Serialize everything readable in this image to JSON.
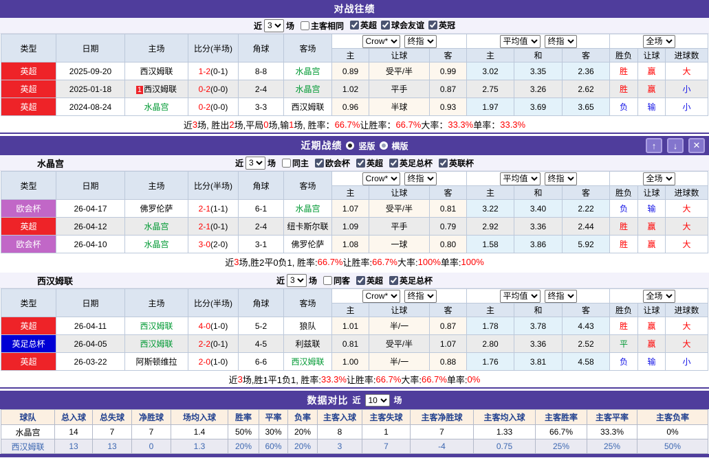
{
  "colors": {
    "accent_purple": "#4f3d9c",
    "button_purple": "#8375cd",
    "league_epl_red": "#ee2328",
    "league_conference_purple": "#c167c7",
    "league_facup_blue": "#0000d5",
    "team_green": "#009933",
    "score_red": "#ff0000",
    "win_red": "#ff0000",
    "lose_blue": "#1212e6",
    "draw_green": "#009933"
  },
  "icons": {
    "up": "↑",
    "down": "↓",
    "close": "✕"
  },
  "matchTable": {
    "cols": [
      "类型",
      "日期",
      "主场",
      "比分(半场)",
      "角球",
      "客场"
    ],
    "subCols": [
      "主",
      "让球",
      "客",
      "主",
      "和",
      "客",
      "胜负",
      "让球",
      "进球数"
    ],
    "dropdowns": [
      "Crow*",
      "终指",
      "平均值",
      "终指",
      "全场"
    ]
  },
  "section1": {
    "title": "对战往绩",
    "filter": {
      "near": "近",
      "count": "3",
      "games": "场",
      "same": {
        "label": "主客相同",
        "checked": false
      },
      "leagues": [
        {
          "label": "英超",
          "checked": true
        },
        {
          "label": "球会友谊",
          "checked": true
        },
        {
          "label": "英冠",
          "checked": true
        }
      ]
    },
    "rows": [
      {
        "type": "英超",
        "tc": "red",
        "date": "2025-09-20",
        "home": "西汉姆联",
        "hg": false,
        "badge": "",
        "ft": "1-2",
        "ht": "(0-1)",
        "corner": "8-8",
        "away": "水晶宫",
        "ag": true,
        "odds": [
          "0.89",
          "受平/半",
          "0.99"
        ],
        "avg": [
          "3.02",
          "3.35",
          "2.36"
        ],
        "res": [
          [
            "胜",
            "r"
          ],
          [
            "赢",
            "r"
          ],
          [
            "大",
            "r"
          ]
        ]
      },
      {
        "type": "英超",
        "tc": "red",
        "date": "2025-01-18",
        "home": "西汉姆联",
        "hg": false,
        "badge": "1",
        "ft": "0-2",
        "ht": "(0-0)",
        "corner": "2-4",
        "away": "水晶宫",
        "ag": true,
        "odds": [
          "1.02",
          "平手",
          "0.87"
        ],
        "avg": [
          "2.75",
          "3.26",
          "2.62"
        ],
        "res": [
          [
            "胜",
            "r"
          ],
          [
            "赢",
            "r"
          ],
          [
            "小",
            "b"
          ]
        ]
      },
      {
        "type": "英超",
        "tc": "red",
        "date": "2024-08-24",
        "home": "水晶宫",
        "hg": true,
        "badge": "",
        "ft": "0-2",
        "ht": "(0-0)",
        "corner": "3-3",
        "away": "西汉姆联",
        "ag": false,
        "odds": [
          "0.96",
          "半球",
          "0.93"
        ],
        "avg": [
          "1.97",
          "3.69",
          "3.65"
        ],
        "res": [
          [
            "负",
            "b"
          ],
          [
            "输",
            "b"
          ],
          [
            "小",
            "b"
          ]
        ]
      }
    ],
    "summary": [
      [
        "近 ",
        0
      ],
      [
        "3",
        1
      ],
      [
        " 场, 胜出 ",
        0
      ],
      [
        "2",
        1
      ],
      [
        " 场,平局 ",
        0
      ],
      [
        "0",
        1
      ],
      [
        " 场,输 ",
        0
      ],
      [
        "1",
        1
      ],
      [
        " 场, 胜率： ",
        0
      ],
      [
        "66.7%",
        1
      ],
      [
        " 让胜率： ",
        0
      ],
      [
        "66.7%",
        1
      ],
      [
        " 大率： ",
        0
      ],
      [
        "33.3%",
        1
      ],
      [
        " 单率： ",
        0
      ],
      [
        "33.3%",
        1
      ]
    ]
  },
  "section2": {
    "title": "近期战绩",
    "radio1": "竖版",
    "radio2": "横版",
    "teams": [
      {
        "name": "水晶宫",
        "filter": {
          "near": "近",
          "count": "3",
          "games": "场",
          "same": {
            "label": "同主",
            "checked": false
          },
          "leagues": [
            {
              "label": "欧会杯",
              "checked": true
            },
            {
              "label": "英超",
              "checked": true
            },
            {
              "label": "英足总杯",
              "checked": true
            },
            {
              "label": "英联杯",
              "checked": true
            }
          ]
        },
        "rows": [
          {
            "type": "欧会杯",
            "tc": "purple",
            "date": "26-04-17",
            "home": "佛罗伦萨",
            "hg": false,
            "badge": "",
            "ft": "2-1",
            "ht": "(1-1)",
            "corner": "6-1",
            "away": "水晶宫",
            "ag": true,
            "odds": [
              "1.07",
              "受平/半",
              "0.81"
            ],
            "avg": [
              "3.22",
              "3.40",
              "2.22"
            ],
            "res": [
              [
                "负",
                "b"
              ],
              [
                "输",
                "b"
              ],
              [
                "大",
                "r"
              ]
            ]
          },
          {
            "type": "英超",
            "tc": "red",
            "date": "26-04-12",
            "home": "水晶宫",
            "hg": true,
            "badge": "",
            "ft": "2-1",
            "ht": "(0-1)",
            "corner": "2-4",
            "away": "纽卡斯尔联",
            "ag": false,
            "odds": [
              "1.09",
              "平手",
              "0.79"
            ],
            "avg": [
              "2.92",
              "3.36",
              "2.44"
            ],
            "res": [
              [
                "胜",
                "r"
              ],
              [
                "赢",
                "r"
              ],
              [
                "大",
                "r"
              ]
            ]
          },
          {
            "type": "欧会杯",
            "tc": "purple",
            "date": "26-04-10",
            "home": "水晶宫",
            "hg": true,
            "badge": "",
            "ft": "3-0",
            "ht": "(2-0)",
            "corner": "3-1",
            "away": "佛罗伦萨",
            "ag": false,
            "odds": [
              "1.08",
              "一球",
              "0.80"
            ],
            "avg": [
              "1.58",
              "3.86",
              "5.92"
            ],
            "res": [
              [
                "胜",
                "r"
              ],
              [
                "赢",
                "r"
              ],
              [
                "大",
                "r"
              ]
            ]
          }
        ],
        "summary": [
          [
            "近",
            0
          ],
          [
            "3",
            1
          ],
          [
            "场,胜2平0负1, 胜率:",
            0
          ],
          [
            "66.7%",
            1
          ],
          [
            " 让胜率:",
            0
          ],
          [
            "66.7%",
            1
          ],
          [
            " 大率:",
            0
          ],
          [
            "100%",
            1
          ],
          [
            " 单率:",
            0
          ],
          [
            "100%",
            1
          ]
        ]
      },
      {
        "name": "西汉姆联",
        "filter": {
          "near": "近",
          "count": "3",
          "games": "场",
          "same": {
            "label": "同客",
            "checked": false
          },
          "leagues": [
            {
              "label": "英超",
              "checked": true
            },
            {
              "label": "英足总杯",
              "checked": true
            }
          ]
        },
        "rows": [
          {
            "type": "英超",
            "tc": "red",
            "date": "26-04-11",
            "home": "西汉姆联",
            "hg": true,
            "badge": "",
            "ft": "4-0",
            "ht": "(1-0)",
            "corner": "5-2",
            "away": "狼队",
            "ag": false,
            "odds": [
              "1.01",
              "半/一",
              "0.87"
            ],
            "avg": [
              "1.78",
              "3.78",
              "4.43"
            ],
            "res": [
              [
                "胜",
                "r"
              ],
              [
                "赢",
                "r"
              ],
              [
                "大",
                "r"
              ]
            ]
          },
          {
            "type": "英足总杯",
            "tc": "blue",
            "date": "26-04-05",
            "home": "西汉姆联",
            "hg": true,
            "badge": "",
            "ft": "2-2",
            "ht": "(0-1)",
            "corner": "4-5",
            "away": "利兹联",
            "ag": false,
            "odds": [
              "0.81",
              "受平/半",
              "1.07"
            ],
            "avg": [
              "2.80",
              "3.36",
              "2.52"
            ],
            "res": [
              [
                "平",
                "g"
              ],
              [
                "赢",
                "r"
              ],
              [
                "大",
                "r"
              ]
            ]
          },
          {
            "type": "英超",
            "tc": "red",
            "date": "26-03-22",
            "home": "阿斯顿维拉",
            "hg": false,
            "badge": "",
            "ft": "2-0",
            "ht": "(1-0)",
            "corner": "6-6",
            "away": "西汉姆联",
            "ag": true,
            "odds": [
              "1.00",
              "半/一",
              "0.88"
            ],
            "avg": [
              "1.76",
              "3.81",
              "4.58"
            ],
            "res": [
              [
                "负",
                "b"
              ],
              [
                "输",
                "b"
              ],
              [
                "小",
                "b"
              ]
            ]
          }
        ],
        "summary": [
          [
            "近",
            0
          ],
          [
            "3",
            1
          ],
          [
            "场,胜1平1负1, 胜率:",
            0
          ],
          [
            "33.3%",
            1
          ],
          [
            " 让胜率:",
            0
          ],
          [
            "66.7%",
            1
          ],
          [
            " 大率:",
            0
          ],
          [
            "66.7%",
            1
          ],
          [
            " 单率:",
            0
          ],
          [
            "0%",
            1
          ]
        ]
      }
    ]
  },
  "section3": {
    "title": "数据对比",
    "near": "近",
    "count": "10",
    "games": "场",
    "headers": [
      "球队",
      "总入球",
      "总失球",
      "净胜球",
      "场均入球",
      "胜率",
      "平率",
      "负率",
      "主客入球",
      "主客失球",
      "主客净胜球",
      "主客均入球",
      "主客胜率",
      "主客平率",
      "主客负率"
    ],
    "rows": [
      {
        "team": "水晶宫",
        "blue": false,
        "values": [
          "14",
          "7",
          "7",
          "1.4",
          "50%",
          "30%",
          "20%",
          "8",
          "1",
          "7",
          "1.33",
          "66.7%",
          "33.3%",
          "0%"
        ]
      },
      {
        "team": "西汉姆联",
        "blue": true,
        "values": [
          "13",
          "13",
          "0",
          "1.3",
          "20%",
          "60%",
          "20%",
          "3",
          "7",
          "-4",
          "0.75",
          "25%",
          "25%",
          "50%"
        ]
      }
    ]
  }
}
